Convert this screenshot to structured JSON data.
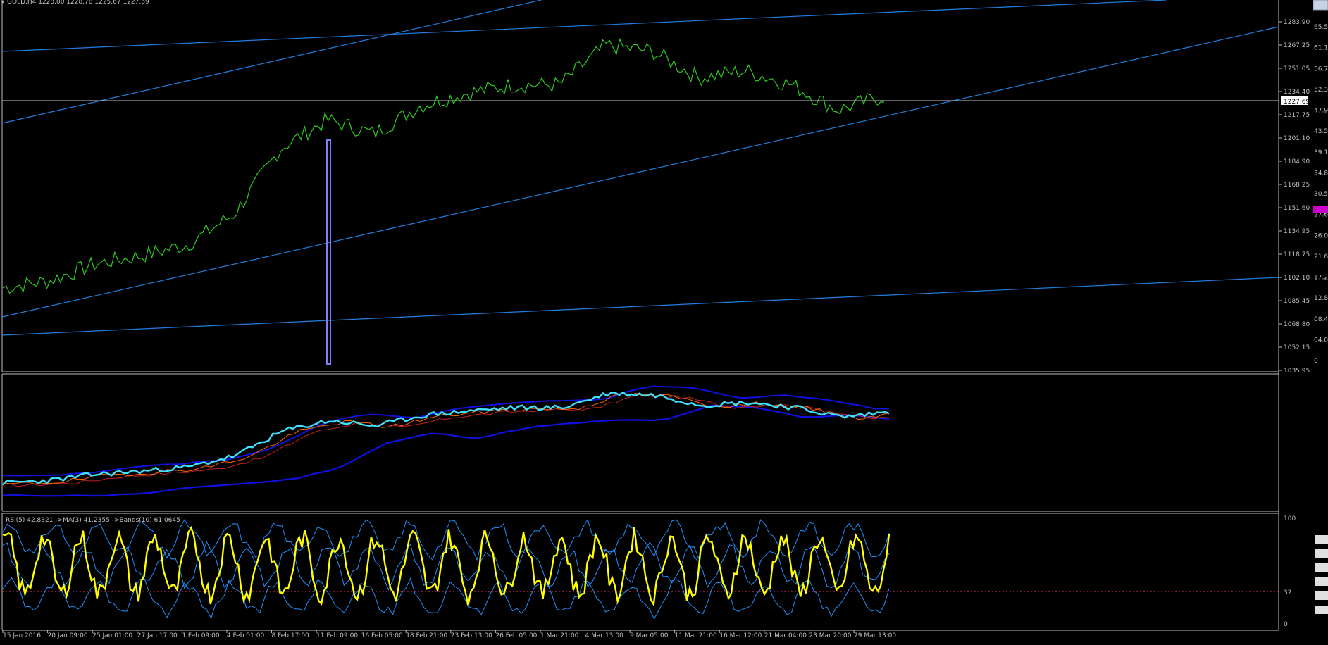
{
  "symbol_header": "GOLD,H4 1228.00 1228.78 1225.67 1227.69",
  "colors": {
    "background": "#000000",
    "grid_frame": "#c0c0c0",
    "price_line": "#2ecc1f",
    "trendline": "#1f7fe0",
    "current_price_line": "#c8c8c8",
    "vertical_bar": "#8080ff",
    "rsi_line": "#ffff00",
    "rsi_bands": "#2090ff",
    "rsi_level_32": "#ff3060",
    "ind_cyan": "#40e0ff",
    "ind_blue": "#1010e0",
    "ind_orange": "#ff6600",
    "ind_red": "#c02020",
    "highlight_label": "#cc00cc"
  },
  "price_axis_labels": [
    "1283.90",
    "1267.25",
    "1251.05",
    "1234.40",
    "1217.75",
    "1201.10",
    "1184.90",
    "1168.25",
    "1151.60",
    "1134.95",
    "1118.75",
    "1102.10",
    "1085.45",
    "1068.80",
    "1052.15",
    "1035.95"
  ],
  "current_price_label": "1227.69",
  "right_edge_labels": [
    "65.5",
    "61.1",
    "56.7",
    "52.3",
    "47.9",
    "43.5",
    "39.1",
    "34.8",
    "30.5",
    "27.6",
    "26.0",
    "21.6",
    "17.2",
    "12.8",
    "08.4",
    "04.0",
    "0"
  ],
  "rsi_header": "RSI(5) 42.8321 ->MA(3) 41.2355 ->Bands(10) 61.0645",
  "rsi_axis_labels": {
    "top": "100",
    "mid": "32",
    "bottom": "0"
  },
  "time_axis_labels": [
    "15 Jan 2016",
    "20 Jan 09:00",
    "25 Jan 01:00",
    "27 Jan 17:00",
    "1 Feb 09:00",
    "4 Feb 01:00",
    "8 Feb 17:00",
    "11 Feb 09:00",
    "16 Feb 05:00",
    "18 Feb 21:00",
    "23 Feb 13:00",
    "26 Feb 05:00",
    "1 Mar 21:00",
    "4 Mar 13:00",
    "9 Mar 05:00",
    "11 Mar 21:00",
    "16 Mar 12:00",
    "21 Mar 04:00",
    "23 Mar 20:00",
    "29 Mar 13:00"
  ],
  "chart_data": [
    {
      "type": "line",
      "title": "GOLD,H4",
      "x": [
        "15 Jan 2016",
        "20 Jan 09:00",
        "25 Jan 01:00",
        "27 Jan 17:00",
        "1 Feb 09:00",
        "4 Feb 01:00",
        "8 Feb 17:00",
        "11 Feb 09:00",
        "16 Feb 05:00",
        "18 Feb 21:00",
        "23 Feb 13:00",
        "26 Feb 05:00",
        "1 Mar 21:00",
        "4 Mar 13:00",
        "9 Mar 05:00",
        "11 Mar 21:00",
        "16 Mar 12:00",
        "21 Mar 04:00",
        "23 Mar 20:00",
        "29 Mar 13:00"
      ],
      "series": [
        {
          "name": "",
          "values": [
            1095,
            1100,
            1112,
            1118,
            1126,
            1148,
            1195,
            1215,
            1205,
            1225,
            1234,
            1240,
            1240,
            1268,
            1264,
            1245,
            1250,
            1240,
            1222,
            1232
          ]
        }
      ],
      "ylim": [
        1035.95,
        1300.55
      ],
      "current_price": 1227.69,
      "grid": false
    },
    {
      "type": "line",
      "title": "RSI(5) 42.8321 ->MA(3) 41.2355 ->Bands(10) 61.0645",
      "ylim": [
        0,
        100
      ],
      "levels": [
        32
      ],
      "series": [
        {
          "name": "RSI(5)",
          "values": [
            72,
            60,
            82,
            55,
            75,
            65,
            85,
            82,
            25,
            72,
            82,
            50,
            85,
            78,
            50,
            70,
            82,
            40,
            55,
            42.83
          ]
        },
        {
          "name": "MA(3)",
          "values": [
            70,
            62,
            78,
            58,
            72,
            66,
            80,
            75,
            35,
            68,
            78,
            55,
            80,
            75,
            55,
            68,
            78,
            45,
            52,
            41.24
          ]
        },
        {
          "name": "Bands(10)",
          "values": [
            78,
            74,
            80,
            72,
            76,
            74,
            84,
            86,
            60,
            74,
            82,
            70,
            84,
            82,
            68,
            74,
            84,
            64,
            62,
            61.06
          ]
        }
      ]
    }
  ]
}
